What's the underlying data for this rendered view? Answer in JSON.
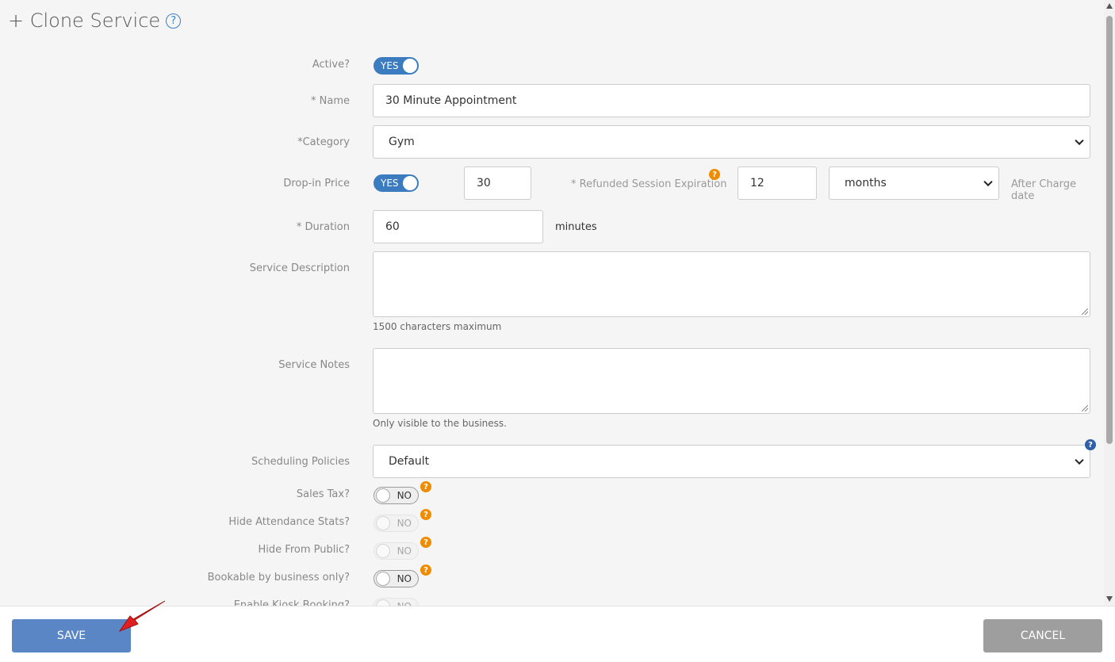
{
  "header": {
    "title": "+ Clone Service",
    "help_glyph": "?"
  },
  "form": {
    "active": {
      "label": "Active?",
      "toggle": "YES"
    },
    "name": {
      "label": "* Name",
      "value": "30 Minute Appointment"
    },
    "category": {
      "label": "*Category",
      "value": "Gym"
    },
    "drop_in_price": {
      "label": "Drop-in Price",
      "toggle": "YES",
      "value": "30"
    },
    "refunded_session_expiration": {
      "label": "* Refunded Session Expiration",
      "value": "12",
      "unit": "months",
      "after_text": "After Charge date"
    },
    "duration": {
      "label": "* Duration",
      "value": "60",
      "unit": "minutes"
    },
    "service_description": {
      "label": "Service Description",
      "value": "",
      "hint": "1500 characters maximum"
    },
    "service_notes": {
      "label": "Service Notes",
      "value": "",
      "hint": "Only visible to the business."
    },
    "scheduling_policies": {
      "label": "Scheduling Policies",
      "value": "Default"
    },
    "sales_tax": {
      "label": "Sales Tax?",
      "toggle": "NO"
    },
    "hide_attendance_stats": {
      "label": "Hide Attendance Stats?",
      "toggle": "NO"
    },
    "hide_from_public": {
      "label": "Hide From Public?",
      "toggle": "NO"
    },
    "bookable_by_business_only": {
      "label": "Bookable by business only?",
      "toggle": "NO"
    },
    "enable_kiosk_booking": {
      "label": "Enable Kiosk Booking?",
      "toggle": "NO"
    }
  },
  "footer": {
    "save_label": "SAVE",
    "cancel_label": "CANCEL"
  },
  "colors": {
    "accent": "#3a7cbf",
    "save": "#5b86c6",
    "cancel": "#9e9e9e",
    "help_badge": "#f08c00",
    "arrow": "#e02020"
  },
  "icons": {
    "help": "question-circle-icon",
    "chevron": "chevron-down-icon",
    "annotation": "red-arrow-icon"
  }
}
